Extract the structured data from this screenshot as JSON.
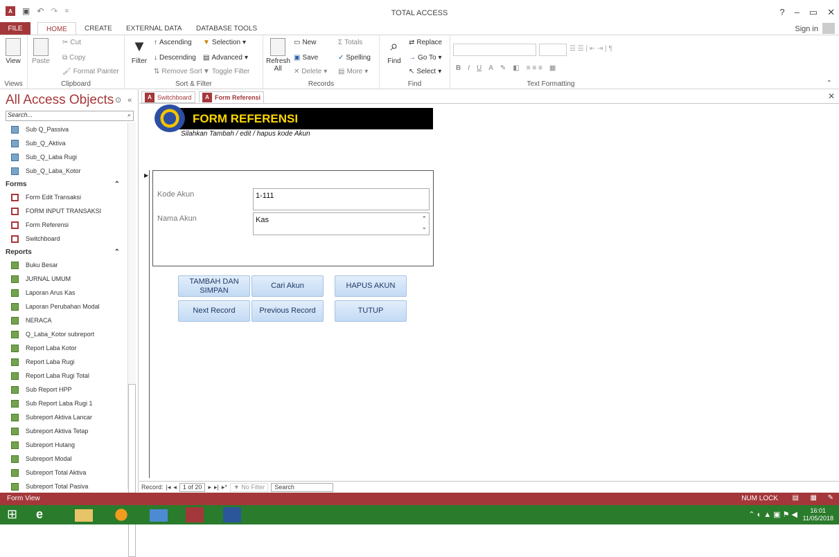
{
  "window": {
    "title": "TOTAL ACCESS",
    "help": "?",
    "minimize": "–",
    "restore": "▭",
    "close": "✕"
  },
  "qat": {
    "undo": "↶",
    "redo": "↷",
    "customize": "="
  },
  "ribbon_tabs": {
    "file": "FILE",
    "home": "HOME",
    "create": "CREATE",
    "external_data": "EXTERNAL DATA",
    "database_tools": "DATABASE TOOLS",
    "sign_in": "Sign in"
  },
  "ribbon": {
    "views": {
      "view": "View",
      "label": "Views"
    },
    "clipboard": {
      "paste": "Paste",
      "cut": "Cut",
      "copy": "Copy",
      "format_painter": "Format Painter",
      "label": "Clipboard"
    },
    "sort_filter": {
      "filter": "Filter",
      "ascending": "Ascending",
      "descending": "Descending",
      "remove_sort": "Remove Sort",
      "selection": "Selection",
      "advanced": "Advanced",
      "toggle_filter": "Toggle Filter",
      "label": "Sort & Filter"
    },
    "records": {
      "refresh_all": "Refresh All",
      "new": "New",
      "save": "Save",
      "delete": "Delete",
      "totals": "Totals",
      "spelling": "Spelling",
      "more": "More",
      "label": "Records"
    },
    "find": {
      "find": "Find",
      "replace": "Replace",
      "go_to": "Go To",
      "select": "Select",
      "label": "Find"
    },
    "text_formatting": {
      "label": "Text Formatting",
      "bold": "B",
      "italic": "I",
      "underline": "U",
      "font_color": "A"
    }
  },
  "nav": {
    "title": "All Access Objects",
    "search_placeholder": "Search...",
    "queries": [
      "Sub Q_Passiva",
      "Sub_Q_Aktiva",
      "Sub_Q_Laba Rugi",
      "Sub_Q_Laba_Kotor"
    ],
    "forms_label": "Forms",
    "forms": [
      "Form Edit Transaksi",
      "FORM INPUT TRANSAKSI",
      "Form Referensi",
      "Switchboard"
    ],
    "reports_label": "Reports",
    "reports": [
      "Buku Besar",
      "JURNAL UMUM",
      "Laporan Arus Kas",
      "Laporan Perubahan Modal",
      "NERACA",
      "Q_Laba_Kotor subreport",
      "Report Laba Kotor",
      "Report Laba Rugi",
      "Report Laba Rugi Total",
      "Sub Report HPP",
      "Sub Report Laba Rugi 1",
      "Subreport Aktiva Lancar",
      "Subreport Aktiva Tetap",
      "Subreport Hutang",
      "Subreport Modal",
      "Subreport Total Aktiva",
      "Subreport Total Pasiva"
    ]
  },
  "doc_tabs": [
    "Switchboard",
    "Form Referensi"
  ],
  "form": {
    "title": "FORM REFERENSI",
    "subtitle": "Silahkan Tambah / edit / hapus kode Akun",
    "kode_akun_label": "Kode Akun",
    "kode_akun_value": "1-111",
    "nama_akun_label": "Nama Akun",
    "nama_akun_value": "Kas",
    "buttons": {
      "tambah": "TAMBAH DAN SIMPAN",
      "cari": "Cari Akun",
      "hapus": "HAPUS AKUN",
      "next": "Next Record",
      "previous": "Previous Record",
      "tutup": "TUTUP"
    }
  },
  "record_nav": {
    "label": "Record:",
    "position": "1 of 20",
    "no_filter": "No Filter",
    "search": "Search"
  },
  "status": {
    "left": "Form View",
    "numlock": "NUM LOCK"
  },
  "taskbar": {
    "time": "16:01",
    "date": "11/05/2018"
  }
}
